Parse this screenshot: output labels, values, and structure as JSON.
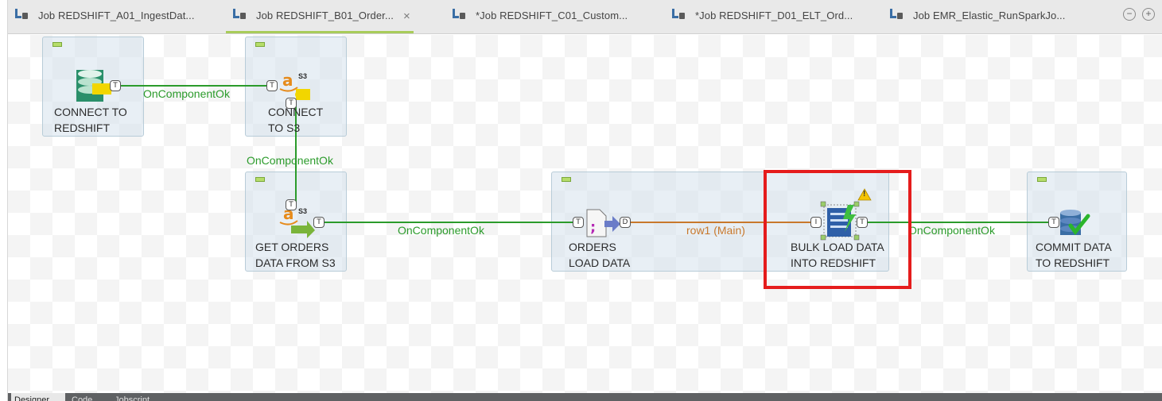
{
  "tabs": [
    {
      "label": "Job REDSHIFT_A01_IngestDat...",
      "active": false
    },
    {
      "label": "Job REDSHIFT_B01_Order...",
      "active": true,
      "close": "×"
    },
    {
      "label": "*Job REDSHIFT_C01_Custom...",
      "active": false
    },
    {
      "label": "*Job REDSHIFT_D01_ELT_Ord...",
      "active": false
    },
    {
      "label": "Job EMR_Elastic_RunSparkJo...",
      "active": false
    }
  ],
  "window_controls": {
    "minimize": "−",
    "maximize": "+"
  },
  "components": {
    "connect_redshift": {
      "line1": "CONNECT TO",
      "line2": "REDSHIFT"
    },
    "connect_s3": {
      "line1": "CONNECT",
      "line2": "TO S3"
    },
    "get_orders": {
      "line1": "GET ORDERS",
      "line2": "DATA FROM S3"
    },
    "orders_load": {
      "line1": "ORDERS",
      "line2": "LOAD DATA"
    },
    "bulk_load": {
      "line1": "BULK LOAD DATA",
      "line2": "INTO REDSHIFT"
    },
    "commit": {
      "line1": "COMMIT DATA",
      "line2": "TO REDSHIFT"
    }
  },
  "flows": {
    "f1": "OnComponentOk",
    "f2": "OnComponentOk",
    "f3": "OnComponentOk",
    "f4": "row1 (Main)",
    "f5": "OnComponentOk"
  },
  "ports": {
    "trigger": "T",
    "data": "D",
    "input": "I"
  },
  "s3_text": "S3",
  "warning": "!",
  "bottom_tabs": [
    "Designer",
    "Code",
    "Jobscript"
  ],
  "colors": {
    "accent_tab": "#a8cc5a",
    "trigger_link": "#2b9b2b",
    "main_link": "#c8782c",
    "highlight": "#e51c1c"
  }
}
